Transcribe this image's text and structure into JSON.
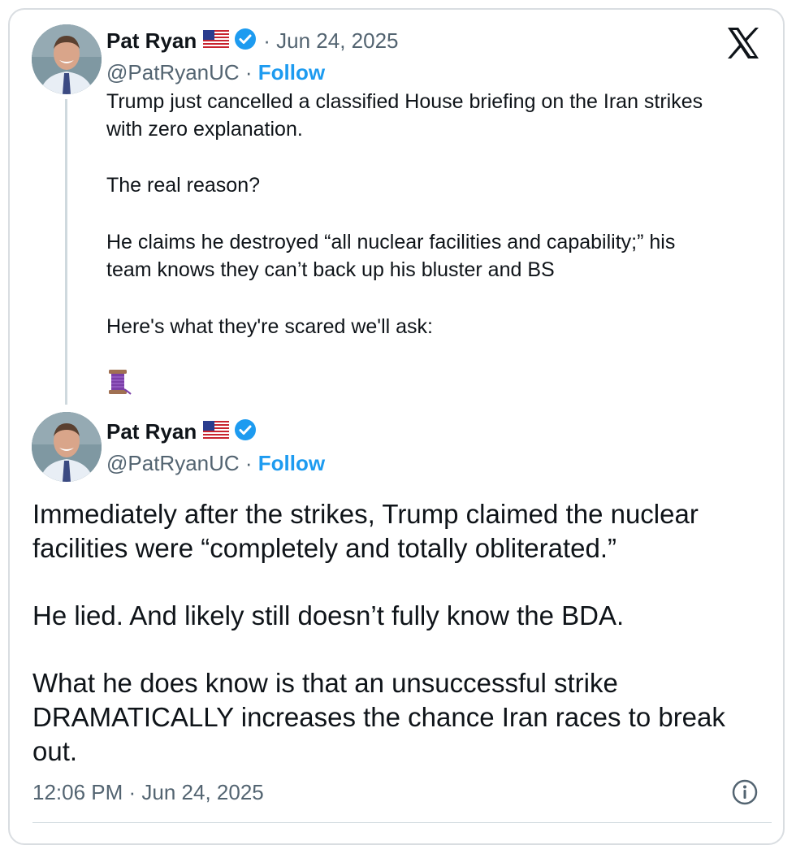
{
  "icons": {
    "logo": "x-logo-icon",
    "verified": "verified-badge-icon",
    "flag": "us-flag-icon",
    "spool": "spool-of-thread-emoji",
    "info": "info-icon"
  },
  "colors": {
    "link": "#1d9bf0",
    "secondary": "#536471",
    "text": "#0f1419",
    "border": "#d9dde1"
  },
  "tweet1": {
    "name": "Pat Ryan",
    "date": "· Jun 24, 2025",
    "handle": "@PatRyanUC ·",
    "follow": "Follow",
    "line1": "Trump just cancelled a classified House briefing on the Iran strikes",
    "line2": "with zero explanation.",
    "line3": "The real reason?",
    "line4": "He claims he destroyed “all nuclear facilities and capability;” his",
    "line5": "team knows they can’t back up his bluster and BS",
    "line6": "Here's what they're scared we'll ask:"
  },
  "tweet2": {
    "name": "Pat Ryan",
    "handle": "@PatRyanUC ·",
    "follow": "Follow",
    "line1": "Immediately after the strikes, Trump claimed the nuclear",
    "line2": "facilities were “completely and totally obliterated.”",
    "line3": "He lied. And likely still doesn’t fully know the BDA.",
    "line4": "What he does know is that an unsuccessful strike",
    "line5": "DRAMATICALLY increases the chance Iran races to break",
    "line6": "out.",
    "timestamp": "12:06 PM · Jun 24, 2025"
  }
}
